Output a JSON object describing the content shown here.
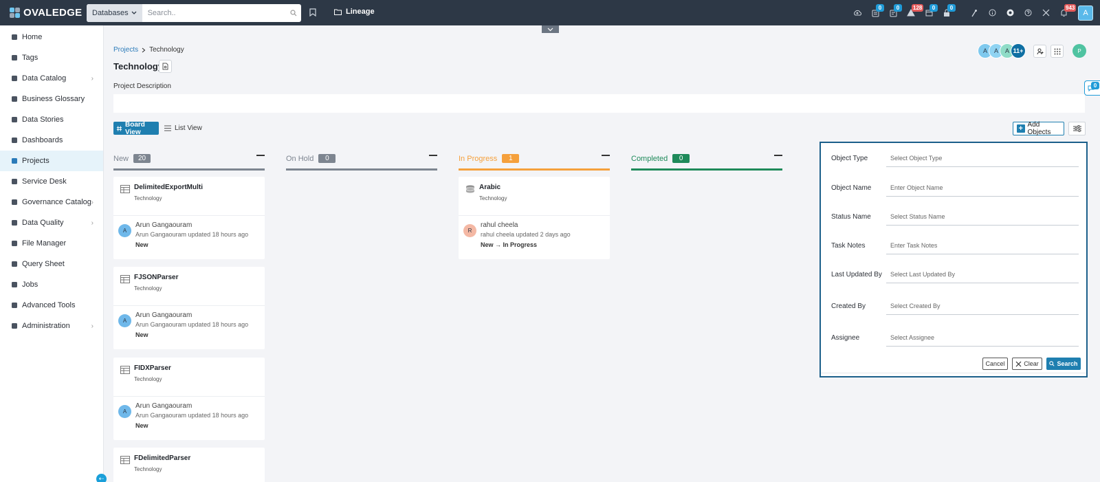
{
  "app": {
    "logo_text": "OVALEDGE",
    "search_scope": "Databases",
    "search_placeholder": "Search..",
    "lineage_label": "Lineage",
    "user_initial": "A"
  },
  "header_icons": [
    {
      "name": "upload-icon",
      "badge": ""
    },
    {
      "name": "inbox-icon",
      "badge": "0",
      "badge_color": "blue"
    },
    {
      "name": "tasks-icon",
      "badge": "0",
      "badge_color": "blue"
    },
    {
      "name": "alert-icon",
      "badge": "128",
      "badge_color": "red"
    },
    {
      "name": "calendar-icon",
      "badge": "0",
      "badge_color": "blue"
    },
    {
      "name": "lock-icon",
      "badge": "0",
      "badge_color": "blue"
    },
    {
      "name": "wand-icon",
      "badge": ""
    },
    {
      "name": "info-icon",
      "badge": ""
    },
    {
      "name": "chrome-icon",
      "badge": ""
    },
    {
      "name": "help-icon",
      "badge": ""
    },
    {
      "name": "expand-icon",
      "badge": ""
    },
    {
      "name": "bell-icon",
      "badge": "943",
      "badge_color": "red"
    }
  ],
  "sidebar": {
    "items": [
      {
        "label": "Home",
        "icon": "home-icon",
        "chevron": false,
        "active": false
      },
      {
        "label": "Tags",
        "icon": "tag-icon",
        "chevron": false,
        "active": false
      },
      {
        "label": "Data Catalog",
        "icon": "catalog-icon",
        "chevron": true,
        "active": false
      },
      {
        "label": "Business Glossary",
        "icon": "glossary-icon",
        "chevron": false,
        "active": false
      },
      {
        "label": "Data Stories",
        "icon": "stories-icon",
        "chevron": false,
        "active": false
      },
      {
        "label": "Dashboards",
        "icon": "dashboard-icon",
        "chevron": false,
        "active": false
      },
      {
        "label": "Projects",
        "icon": "projects-icon",
        "chevron": false,
        "active": true
      },
      {
        "label": "Service Desk",
        "icon": "service-desk-icon",
        "chevron": false,
        "active": false
      },
      {
        "label": "Governance Catalog",
        "icon": "governance-icon",
        "chevron": true,
        "active": false
      },
      {
        "label": "Data Quality",
        "icon": "quality-icon",
        "chevron": true,
        "active": false
      },
      {
        "label": "File Manager",
        "icon": "file-icon",
        "chevron": false,
        "active": false
      },
      {
        "label": "Query Sheet",
        "icon": "query-icon",
        "chevron": false,
        "active": false
      },
      {
        "label": "Jobs",
        "icon": "jobs-icon",
        "chevron": false,
        "active": false
      },
      {
        "label": "Advanced Tools",
        "icon": "tools-icon",
        "chevron": false,
        "active": false
      },
      {
        "label": "Administration",
        "icon": "admin-icon",
        "chevron": true,
        "active": false
      }
    ]
  },
  "page": {
    "breadcrumb_parent": "Projects",
    "breadcrumb_current": "Technology",
    "title": "Technology",
    "description_label": "Project Description",
    "members": [
      "A",
      "A",
      "A"
    ],
    "members_more": "11+",
    "owner_initial": "P",
    "chat_badge": "0"
  },
  "views": {
    "board": "Board View",
    "list": "List View",
    "add_objects": "Add Objects"
  },
  "columns": [
    {
      "name": "New",
      "count": "20",
      "color": "#7d8590"
    },
    {
      "name": "On Hold",
      "count": "0",
      "color": "#7d8590"
    },
    {
      "name": "In Progress",
      "count": "1",
      "color": "#f5a03c"
    },
    {
      "name": "Completed",
      "count": "0",
      "color": "#1e8a5a"
    }
  ],
  "cards": {
    "new": [
      {
        "title": "DelimitedExportMulti",
        "sub": "Technology",
        "initial": "A",
        "user": "Arun Gangaouram",
        "updated": "Arun Gangaouram updated 18 hours ago",
        "status": "New"
      },
      {
        "title": "FJSONParser",
        "sub": "Technology",
        "initial": "A",
        "user": "Arun Gangaouram",
        "updated": "Arun Gangaouram updated 18 hours ago",
        "status": "New"
      },
      {
        "title": "FIDXParser",
        "sub": "Technology",
        "initial": "A",
        "user": "Arun Gangaouram",
        "updated": "Arun Gangaouram updated 18 hours ago",
        "status": "New"
      },
      {
        "title": "FDelimitedParser",
        "sub": "Technology",
        "initial": "",
        "user": "",
        "updated": "",
        "status": ""
      }
    ],
    "in_progress": [
      {
        "title": "Arabic",
        "sub": "Technology",
        "initial": "R",
        "user": "rahul cheela",
        "updated": "rahul cheela updated 2 days ago",
        "status": "New → In Progress"
      }
    ]
  },
  "filter": {
    "fields": [
      {
        "label": "Object Type",
        "placeholder": "Select Object Type"
      },
      {
        "label": "Object Name",
        "placeholder": "Enter Object Name"
      },
      {
        "label": "Status Name",
        "placeholder": "Select Status Name"
      },
      {
        "label": "Task Notes",
        "placeholder": "Enter Task Notes"
      },
      {
        "label": "Last Updated By",
        "placeholder": "Select Last Updated By"
      },
      {
        "label": "Created By",
        "placeholder": "Select Created By"
      },
      {
        "label": "Assignee",
        "placeholder": "Select Assignee"
      }
    ],
    "cancel": "Cancel",
    "clear": "Clear",
    "search": "Search"
  },
  "colors": {
    "topbar": "#2d3846",
    "accent": "#1f7fb0",
    "panel_border": "#1b5f8a"
  }
}
